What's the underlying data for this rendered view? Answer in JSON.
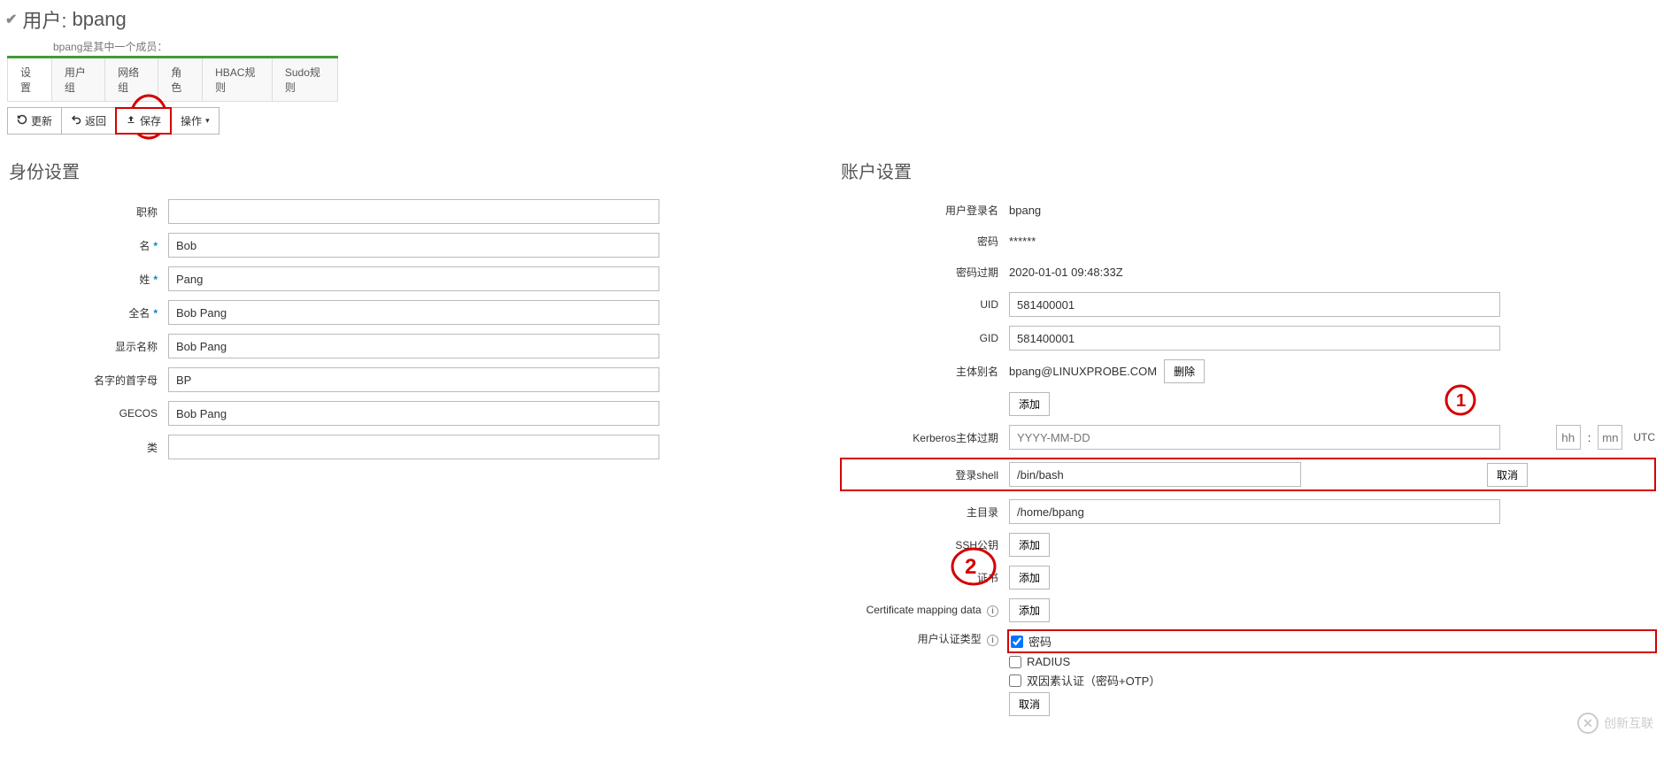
{
  "page": {
    "title_prefix": "用户:",
    "username": "bpang",
    "subtitle": "bpang是其中一个成员："
  },
  "tabs": {
    "settings": "设置",
    "user_group": "用户组",
    "net_group": "网络组",
    "role": "角色",
    "hbac": "HBAC规则",
    "sudo": "Sudo规则"
  },
  "actions": {
    "refresh": "更新",
    "back": "返回",
    "save": "保存",
    "operate": "操作"
  },
  "identity": {
    "section_title": "身份设置",
    "job_title_label": "职称",
    "job_title_value": "",
    "first_name_label": "名",
    "first_name_value": "Bob",
    "last_name_label": "姓",
    "last_name_value": "Pang",
    "full_name_label": "全名",
    "full_name_value": "Bob Pang",
    "display_name_label": "显示名称",
    "display_name_value": "Bob Pang",
    "initials_label": "名字的首字母",
    "initials_value": "BP",
    "gecos_label": "GECOS",
    "gecos_value": "Bob Pang",
    "class_label": "类",
    "class_value": ""
  },
  "account": {
    "section_title": "账户设置",
    "login_name_label": "用户登录名",
    "login_name_value": "bpang",
    "password_label": "密码",
    "password_value": "******",
    "password_expire_label": "密码过期",
    "password_expire_value": "2020-01-01 09:48:33Z",
    "uid_label": "UID",
    "uid_value": "581400001",
    "gid_label": "GID",
    "gid_value": "581400001",
    "principal_alias_label": "主体别名",
    "principal_alias_value": "bpang@LINUXPROBE.COM",
    "delete_btn": "删除",
    "add_btn": "添加",
    "krb_expire_label": "Kerberos主体过期",
    "krb_date_placeholder": "YYYY-MM-DD",
    "krb_hh_placeholder": "hh",
    "krb_mm_placeholder": "mn",
    "krb_utc": "UTC",
    "login_shell_label": "登录shell",
    "login_shell_value": "/bin/bash",
    "cancel_btn": "取消",
    "home_dir_label": "主目录",
    "home_dir_value": "/home/bpang",
    "ssh_key_label": "SSH公钥",
    "cert_label": "证书",
    "cert_map_label": "Certificate mapping data",
    "auth_type_label": "用户认证类型",
    "auth_password": "密码",
    "auth_radius": "RADIUS",
    "auth_twofactor": "双因素认证（密码+OTP）",
    "cancel2_btn": "取消"
  },
  "watermark": {
    "text": "创新互联"
  }
}
